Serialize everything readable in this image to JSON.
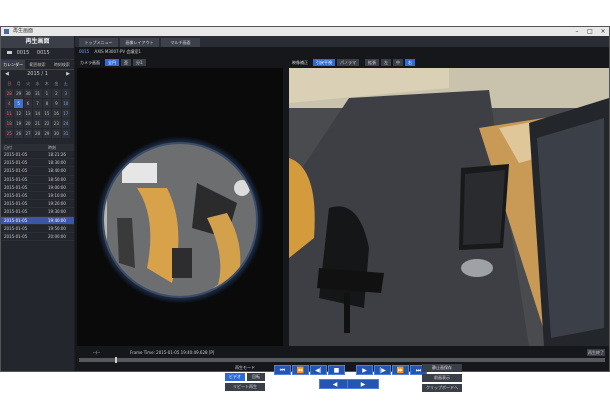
{
  "window": {
    "title": "再生画面"
  },
  "sidebar": {
    "header": "再生画面",
    "camera_id": "0015",
    "camera_label": "0015",
    "tabs": [
      "カレンダー",
      "範囲検索",
      "時刻検索"
    ],
    "calendar": {
      "month_label": "2015 / 1",
      "prev": "◀",
      "next": "▶",
      "weekdays": [
        "日",
        "月",
        "火",
        "水",
        "木",
        "金",
        "土"
      ],
      "days": [
        "28",
        "29",
        "30",
        "31",
        "1",
        "2",
        "3",
        "4",
        "5",
        "6",
        "7",
        "8",
        "9",
        "10",
        "11",
        "12",
        "13",
        "14",
        "15",
        "16",
        "17",
        "18",
        "19",
        "20",
        "21",
        "22",
        "23",
        "24",
        "25",
        "26",
        "27",
        "28",
        "29",
        "30",
        "31"
      ]
    },
    "list_headers": [
      "日付",
      "時刻"
    ],
    "recordings": [
      [
        "2015-01-05",
        "18:21:26"
      ],
      [
        "2015-01-05",
        "18:30:00"
      ],
      [
        "2015-01-05",
        "18:40:00"
      ],
      [
        "2015-01-05",
        "18:50:00"
      ],
      [
        "2015-01-05",
        "19:00:00"
      ],
      [
        "2015-01-05",
        "19:10:00"
      ],
      [
        "2015-01-05",
        "19:20:00"
      ],
      [
        "2015-01-05",
        "19:30:00"
      ],
      [
        "2015-01-05",
        "19:40:00"
      ],
      [
        "2015-01-05",
        "19:50:00"
      ],
      [
        "2015-01-05",
        "20:00:00"
      ]
    ]
  },
  "top_tabs": [
    "トップメニュー",
    "画像レイアウト",
    "マルチ画面"
  ],
  "camera_line": {
    "id": "0015",
    "name": "AXIS M3007-PV 会議室1"
  },
  "left_toolbar": {
    "label": "カメラ画面",
    "buttons": [
      "全円",
      "歪",
      "分1"
    ]
  },
  "right_toolbar": {
    "label": "映像補正",
    "buttons": [
      "引戻平視",
      "パノラマ",
      "拡張",
      "左",
      "中",
      "右"
    ]
  },
  "status": {
    "dash": "--/--",
    "frame_time": "Frame Time:  2015-01-05 19:40:49.628   [P]",
    "button": "再生終了"
  },
  "controls": {
    "mode_label": "再生モード",
    "mode_buttons": [
      "ビデオ",
      "回転"
    ],
    "repeat": "リピート再生",
    "transport_top": [
      "⏮",
      "⏪",
      "◀|",
      "■",
      "▶",
      "|▶",
      "⏩",
      "⏭"
    ],
    "transport_bottom": [
      "◀",
      "▶"
    ],
    "right_buttons": [
      "静止画保存",
      "前画表示",
      "クリップボードへ"
    ]
  }
}
